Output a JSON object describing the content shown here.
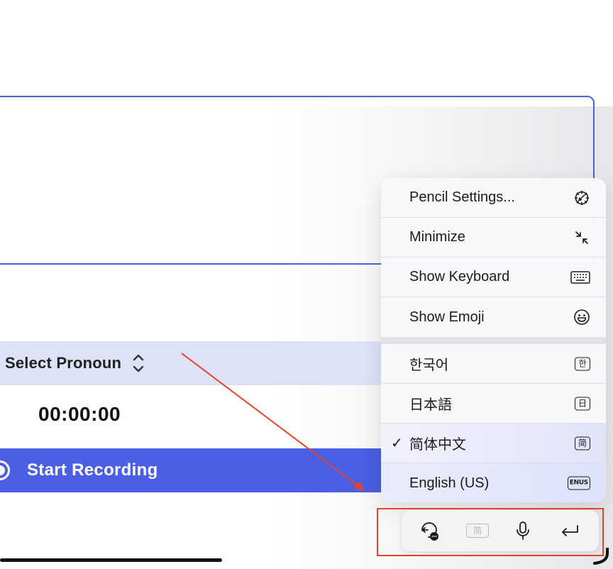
{
  "form": {
    "pronoun_label": "Select Pronoun",
    "timer": "00:00:00",
    "record_label": "Start Recording"
  },
  "menu": {
    "items": [
      {
        "label": "Pencil Settings...",
        "icon": "pencil-settings-icon"
      },
      {
        "label": "Minimize",
        "icon": "minimize-icon"
      },
      {
        "label": "Show Keyboard",
        "icon": "keyboard-icon"
      },
      {
        "label": "Show Emoji",
        "icon": "emoji-icon"
      }
    ],
    "languages": [
      {
        "label": "한국어",
        "badge": "한",
        "selected": false
      },
      {
        "label": "日本語",
        "badge": "日",
        "selected": false
      },
      {
        "label": "简体中文",
        "badge": "简",
        "selected": true
      },
      {
        "label": "English (US)",
        "badge": "ENUS",
        "selected": false
      }
    ],
    "checkmark": "✓"
  },
  "toolbar": {
    "lang_badge": "简",
    "buttons": [
      "undo-more-icon",
      "language-badge",
      "microphone-icon",
      "return-icon"
    ]
  },
  "colors": {
    "accent": "#4a5fe3",
    "pronoun_bg": "#dde2f7",
    "annotation": "#e2452a"
  }
}
